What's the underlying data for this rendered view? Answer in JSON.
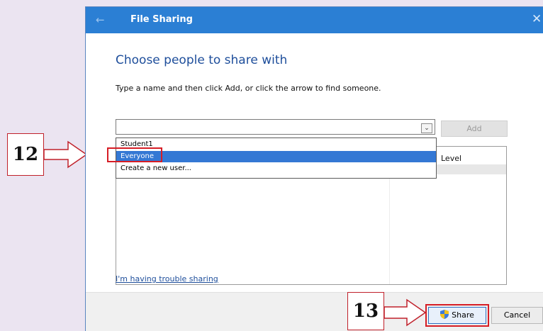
{
  "window": {
    "title": "File Sharing",
    "back_icon": "←",
    "close_icon": "✕"
  },
  "main": {
    "heading": "Choose people to share with",
    "instruction": "Type a name and then click Add, or click the arrow to find someone.",
    "combo_value": "",
    "combo_arrow": "⌄",
    "add_label": "Add",
    "level_header": "Level",
    "dropdown_items": [
      "Student1",
      "Everyone",
      "Create a new user..."
    ],
    "dropdown_selected": "Everyone",
    "trouble_link": "I'm having trouble sharing"
  },
  "footer": {
    "share_label": "Share",
    "cancel_label": "Cancel"
  },
  "annotations": {
    "step12": "12",
    "step13": "13",
    "color": "#d61d25"
  }
}
